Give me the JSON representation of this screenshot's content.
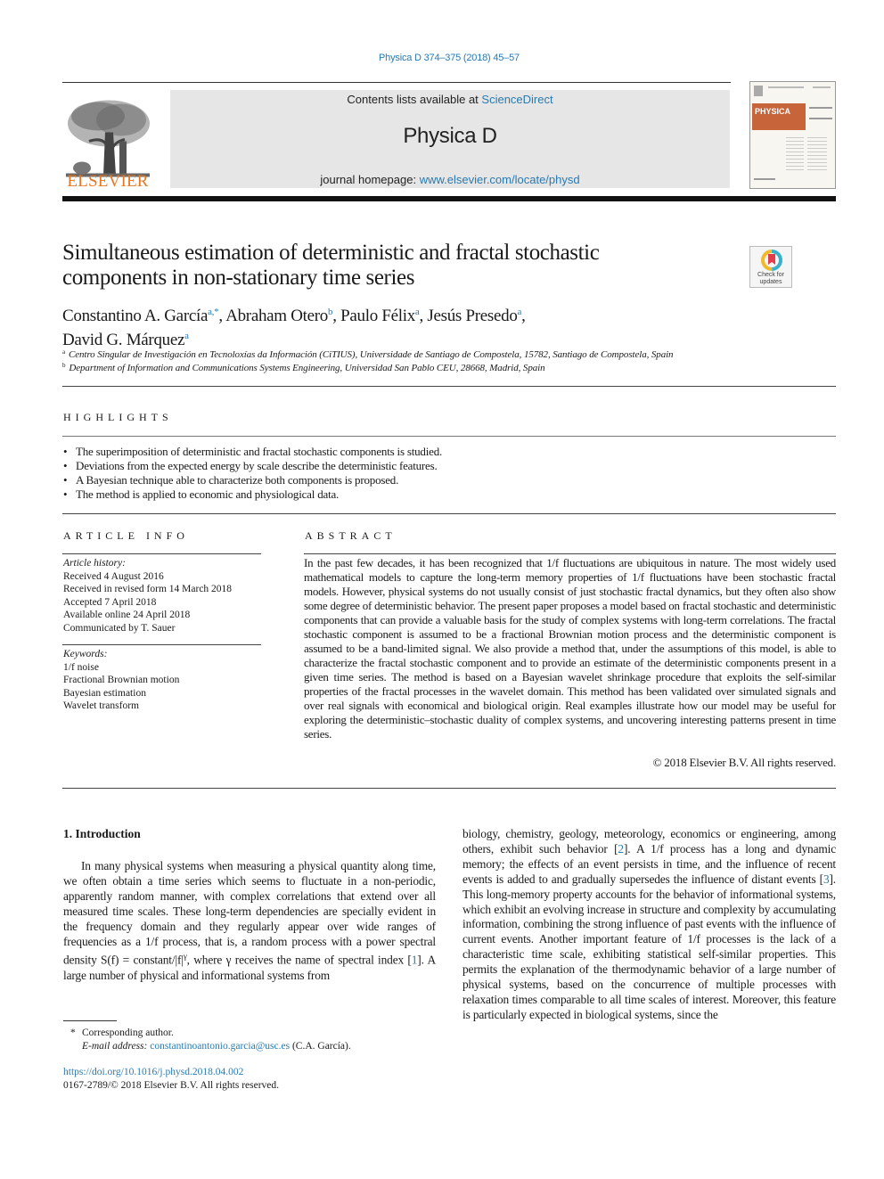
{
  "journal_ref": "Physica D 374–375 (2018) 45–57",
  "header": {
    "publisher": "ELSEVIER",
    "contents_prefix": "Contents lists available at ",
    "contents_link": "ScienceDirect",
    "journal_name": "Physica D",
    "homepage_prefix": "journal homepage: ",
    "homepage_link": "www.elsevier.com/locate/physd",
    "cover_title": "PHYSICA"
  },
  "crossmark": {
    "label_line1": "Check for",
    "label_line2": "updates"
  },
  "article": {
    "title_line1": "Simultaneous estimation of deterministic and fractal stochastic",
    "title_line2": "components in non-stationary time series",
    "authors": [
      {
        "name": "Constantino A. García",
        "sup": "a,*",
        "sep": ", "
      },
      {
        "name": "Abraham Otero",
        "sup": "b",
        "sep": ", "
      },
      {
        "name": "Paulo Félix",
        "sup": "a",
        "sep": ", "
      },
      {
        "name": "Jesús Presedo",
        "sup": "a",
        "sep": ","
      },
      {
        "name": "David G. Márquez",
        "sup": "a",
        "sep": ""
      }
    ],
    "affiliations": [
      {
        "key": "a",
        "text": "Centro Singular de Investigación en Tecnoloxías da Información (CiTIUS), Universidade de Santiago de Compostela, 15782, Santiago de Compostela, Spain"
      },
      {
        "key": "b",
        "text": "Department of Information and Communications Systems Engineering, Universidad San Pablo CEU, 28668, Madrid, Spain"
      }
    ]
  },
  "highlights": {
    "label": "HIGHLIGHTS",
    "items": [
      "The superimposition of deterministic and fractal stochastic components is studied.",
      "Deviations from the expected energy by scale describe the deterministic features.",
      "A Bayesian technique able to characterize both components is proposed.",
      "The method is applied to economic and physiological data."
    ]
  },
  "article_info": {
    "label": "ARTICLE INFO",
    "history_label": "Article history:",
    "history": [
      "Received 4 August 2016",
      "Received in revised form 14 March 2018",
      "Accepted 7 April 2018",
      "Available online 24 April 2018",
      "Communicated by T. Sauer"
    ],
    "keywords_label": "Keywords:",
    "keywords": [
      "1/f noise",
      "Fractional Brownian motion",
      "Bayesian estimation",
      "Wavelet transform"
    ]
  },
  "abstract": {
    "label": "ABSTRACT",
    "text": "In the past few decades, it has been recognized that 1/f fluctuations are ubiquitous in nature. The most widely used mathematical models to capture the long-term memory properties of 1/f fluctuations have been stochastic fractal models. However, physical systems do not usually consist of just stochastic fractal dynamics, but they often also show some degree of deterministic behavior. The present paper proposes a model based on fractal stochastic and deterministic components that can provide a valuable basis for the study of complex systems with long-term correlations. The fractal stochastic component is assumed to be a fractional Brownian motion process and the deterministic component is assumed to be a band-limited signal. We also provide a method that, under the assumptions of this model, is able to characterize the fractal stochastic component and to provide an estimate of the deterministic components present in a given time series. The method is based on a Bayesian wavelet shrinkage procedure that exploits the self-similar properties of the fractal processes in the wavelet domain. This method has been validated over simulated signals and over real signals with economical and biological origin. Real examples illustrate how our model may be useful for exploring the deterministic–stochastic duality of complex systems, and uncovering interesting patterns present in time series.",
    "copyright": "© 2018 Elsevier B.V. All rights reserved."
  },
  "introduction": {
    "heading": "1.  Introduction",
    "left_p1": "In many physical systems when measuring a physical quantity along time, we often obtain a time series which seems to fluctuate in a non-periodic, apparently random manner, with complex correlations that extend over all measured time scales. These long-term dependencies are specially evident in the frequency domain and they regularly appear over wide ranges of frequencies as a 1/f process, that is, a random process with a power spectral density S(f) = constant/|f|",
    "left_gamma_sup": "γ",
    "left_p1_b": ", where γ receives the name of spectral index [",
    "ref1": "1",
    "left_p1_c": "]. A large number of physical and informational systems from",
    "right_a": "biology, chemistry, geology, meteorology, economics or engineering, among others, exhibit such behavior [",
    "ref2": "2",
    "right_b": "]. A 1/f process has a long and dynamic memory; the effects of an event persists in time, and the influence of recent events is added to and gradually supersedes the influence of distant events [",
    "ref3": "3",
    "right_c": "]. This long-memory property accounts for the behavior of informational systems, which exhibit an evolving increase in structure and complexity by accumulating information, combining the strong influence of past events with the influence of current events. Another important feature of 1/f processes is the lack of a characteristic time scale, exhibiting statistical self-similar properties. This permits the explanation of the thermodynamic behavior of a large number of physical systems, based on the concurrence of multiple processes with relaxation times comparable to all time scales of interest. Moreover, this feature is particularly expected in biological systems, since the"
  },
  "footnote": {
    "star": "*",
    "corresponding": "Corresponding author.",
    "email_label": "E-mail address: ",
    "email": "constantinoantonio.garcia@usc.es",
    "email_suffix": " (C.A. García)."
  },
  "doi": "https://doi.org/10.1016/j.physd.2018.04.002",
  "issn_line": "0167-2789/© 2018 Elsevier B.V. All rights reserved."
}
